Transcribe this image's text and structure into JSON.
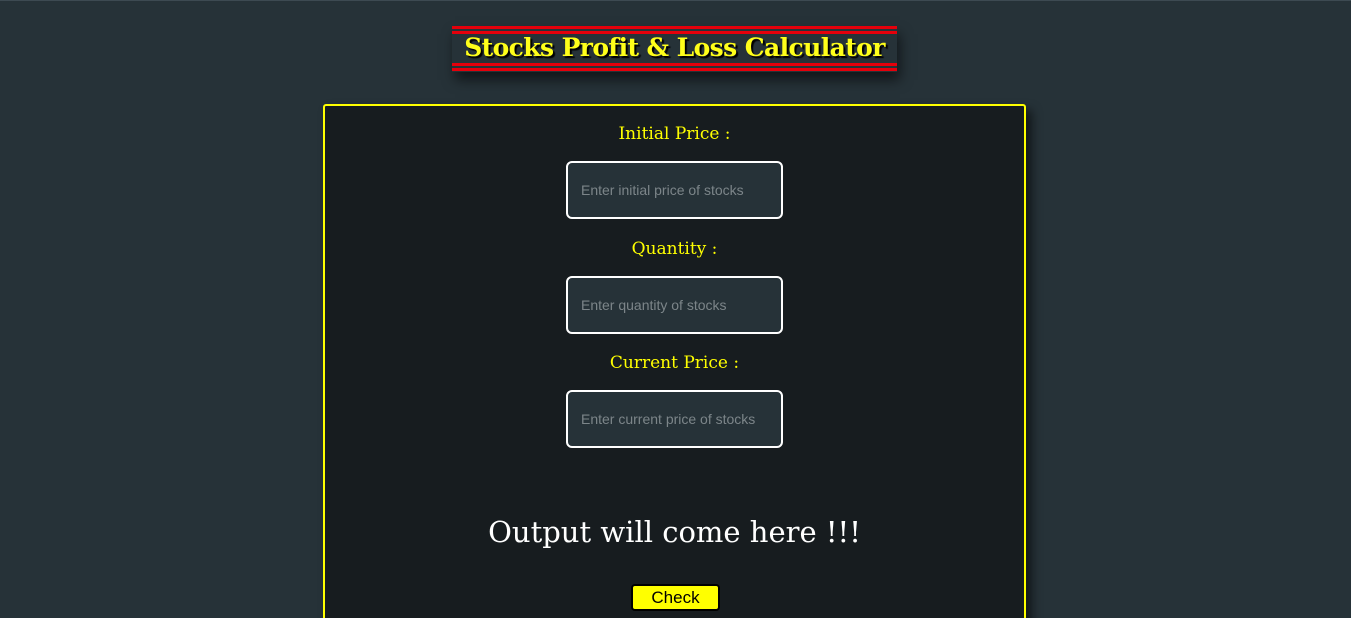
{
  "header": {
    "title": "Stocks Profit & Loss Calculator"
  },
  "form": {
    "initial_price_label": "Initial Price :",
    "initial_price_placeholder": "Enter initial price of stocks",
    "quantity_label": "Quantity :",
    "quantity_placeholder": "Enter quantity of stocks",
    "current_price_label": "Current Price :",
    "current_price_placeholder": "Enter current price of stocks",
    "output_text": "Output will come here !!!",
    "check_label": "Check"
  },
  "colors": {
    "background": "#263238",
    "card_background": "#171c1f",
    "accent": "#ffff00",
    "title_stripe": "#e5000b"
  }
}
